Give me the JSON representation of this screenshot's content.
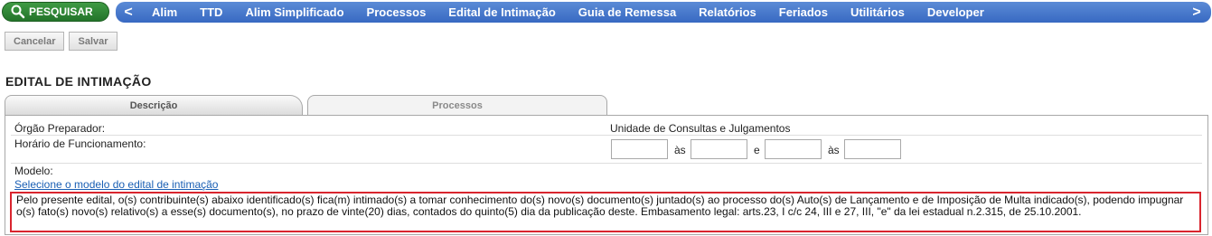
{
  "topbar": {
    "search_label": "PESQUISAR",
    "nav_left": "<",
    "nav_right": ">",
    "nav_items": [
      "Alim",
      "TTD",
      "Alim Simplificado",
      "Processos",
      "Edital de Intimação",
      "Guia de Remessa",
      "Relatórios",
      "Feriados",
      "Utilitários",
      "Developer"
    ]
  },
  "actions": {
    "cancel": "Cancelar",
    "save": "Salvar"
  },
  "page_title": "EDITAL DE INTIMAÇÃO",
  "tabs": [
    {
      "label": "Descrição",
      "active": true
    },
    {
      "label": "Processos",
      "active": false
    }
  ],
  "form": {
    "orgao_label": "Órgão Preparador:",
    "orgao_value": "Unidade de Consultas e Julgamentos",
    "horario_label": "Horário de Funcionamento:",
    "horario_sep1": "às",
    "horario_sep2": "e",
    "horario_sep3": "às",
    "horario_values": [
      "",
      "",
      "",
      ""
    ],
    "modelo_label": "Modelo:",
    "modelo_link": "Selecione o modelo do edital de intimação",
    "edital_text": "Pelo presente edital, o(s) contribuinte(s) abaixo identificado(s) fica(m) intimado(s) a tomar conhecimento do(s) novo(s) documento(s) juntado(s) ao processo do(s) Auto(s) de Lançamento e de Imposição de Multa indicado(s), podendo impugnar o(s) fato(s) novo(s) relativo(s) a esse(s) documento(s), no prazo de vinte(20) dias, contados do quinto(5) dia da publicação deste. Embasamento legal: arts.23, I c/c 24, III e 27, III, \"e\" da lei estadual n.2.315, de 25.10.2001."
  },
  "colors": {
    "nav_blue": "#3f72c9",
    "search_green": "#2e8a35",
    "highlight_red": "#d9252e",
    "link_blue": "#1a5fb4"
  }
}
